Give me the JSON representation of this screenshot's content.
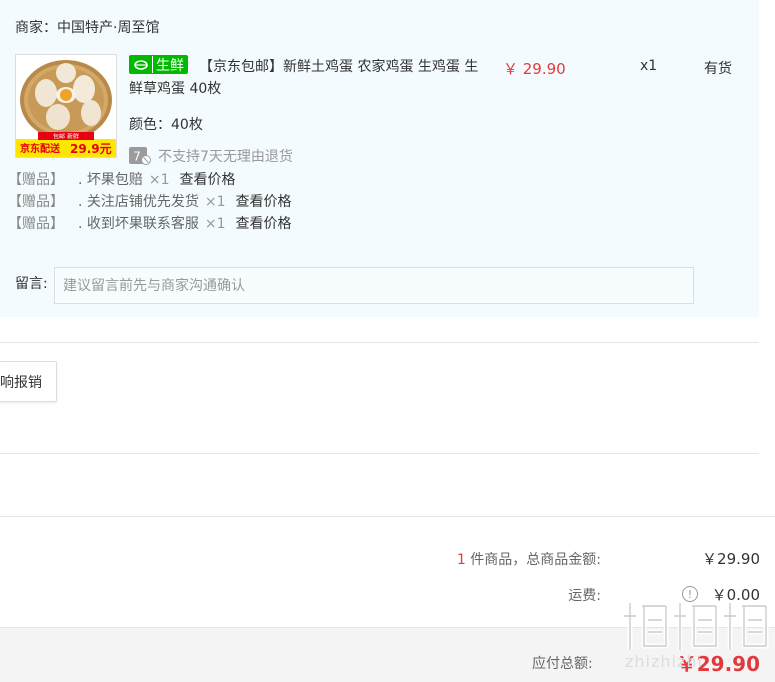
{
  "merchant": {
    "label": "商家：中国特产·周至馆"
  },
  "product": {
    "badge_text": "生鲜",
    "title": "【京东包邮】新鲜土鸡蛋 农家鸡蛋 生鸡蛋 生鲜草鸡蛋 40枚",
    "color": "颜色：40枚",
    "price": "￥ 29.90",
    "qty": "x1",
    "stock": "有货",
    "thumb_banner": "京东配送",
    "thumb_price": "29.9元",
    "thumb_tag": "包邮 新鲜"
  },
  "return_policy": {
    "icon_text": "7",
    "text": "不支持7天无理由退货"
  },
  "gifts": [
    {
      "tag": "【赠品】",
      "name": ". 坏果包赔",
      "qty": "×1",
      "link": "查看价格"
    },
    {
      "tag": "【赠品】",
      "name": ". 关注店铺优先发货",
      "qty": "×1",
      "link": "查看价格"
    },
    {
      "tag": "【赠品】",
      "name": ". 收到坏果联系客服",
      "qty": "×1",
      "link": "查看价格"
    }
  ],
  "remark": {
    "label": "留言:",
    "placeholder": "建议留言前先与商家沟通确认"
  },
  "expense_button": {
    "label": "响报销"
  },
  "summary": {
    "count_num": "1",
    "count_label": " 件商品，总商品金额:",
    "goods_total": "￥29.90",
    "freight_label": "运费:",
    "freight_value": "￥0.00",
    "payable_label": "应付总额:",
    "payable_value": "￥29.90"
  },
  "watermark": {
    "text": "zhizhizhi"
  },
  "colors": {
    "accent_red": "#e4393c",
    "fresh_green": "#00b900",
    "panel_bg": "#f3fbfe"
  }
}
